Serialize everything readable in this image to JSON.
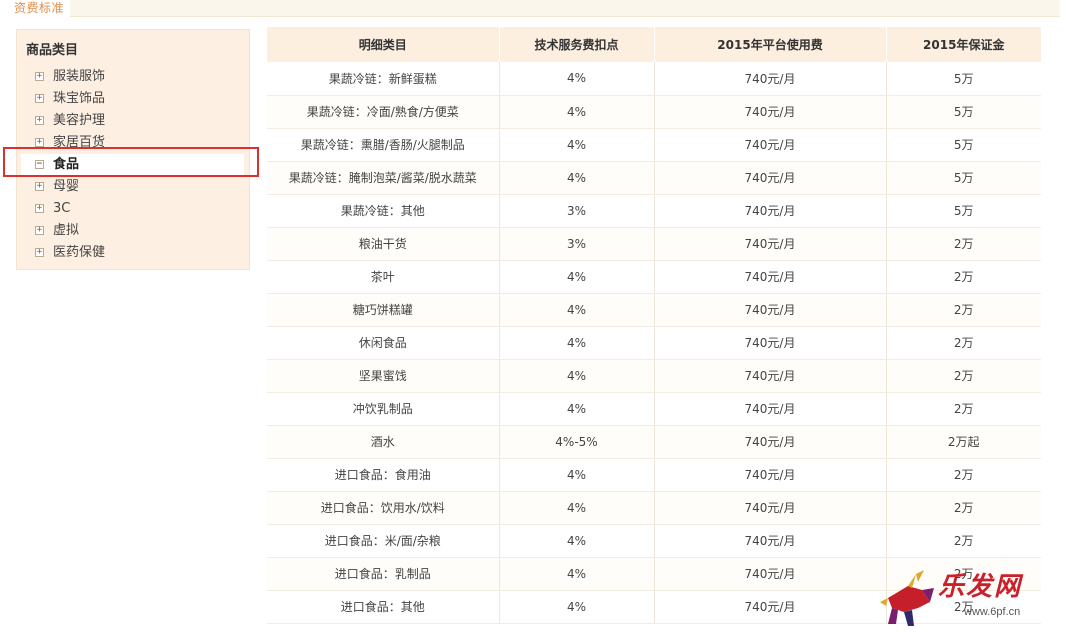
{
  "header": {
    "title": "资费标准"
  },
  "sidebar": {
    "title": "商品类目",
    "items": [
      {
        "label": "服装服饰",
        "toggle": "+"
      },
      {
        "label": "珠宝饰品",
        "toggle": "+"
      },
      {
        "label": "美容护理",
        "toggle": "+"
      },
      {
        "label": "家居百货",
        "toggle": "+"
      },
      {
        "label": "食品",
        "toggle": "−"
      },
      {
        "label": "母婴",
        "toggle": "+"
      },
      {
        "label": "3C",
        "toggle": "+"
      },
      {
        "label": "虚拟",
        "toggle": "+"
      },
      {
        "label": "医药保健",
        "toggle": "+"
      }
    ]
  },
  "table": {
    "headers": [
      "明细类目",
      "技术服务费扣点",
      "2015年平台使用费",
      "2015年保证金"
    ],
    "rows": [
      [
        "果蔬冷链：新鲜蛋糕",
        "4%",
        "740元/月",
        "5万"
      ],
      [
        "果蔬冷链：冷面/熟食/方便菜",
        "4%",
        "740元/月",
        "5万"
      ],
      [
        "果蔬冷链：熏腊/香肠/火腿制品",
        "4%",
        "740元/月",
        "5万"
      ],
      [
        "果蔬冷链：腌制泡菜/酱菜/脱水蔬菜",
        "4%",
        "740元/月",
        "5万"
      ],
      [
        "果蔬冷链：其他",
        "3%",
        "740元/月",
        "5万"
      ],
      [
        "粮油干货",
        "3%",
        "740元/月",
        "2万"
      ],
      [
        "茶叶",
        "4%",
        "740元/月",
        "2万"
      ],
      [
        "糖巧饼糕罐",
        "4%",
        "740元/月",
        "2万"
      ],
      [
        "休闲食品",
        "4%",
        "740元/月",
        "2万"
      ],
      [
        "坚果蜜饯",
        "4%",
        "740元/月",
        "2万"
      ],
      [
        "冲饮乳制品",
        "4%",
        "740元/月",
        "2万"
      ],
      [
        "酒水",
        "4%-5%",
        "740元/月",
        "2万起"
      ],
      [
        "进口食品：食用油",
        "4%",
        "740元/月",
        "2万"
      ],
      [
        "进口食品：饮用水/饮料",
        "4%",
        "740元/月",
        "2万"
      ],
      [
        "进口食品：米/面/杂粮",
        "4%",
        "740元/月",
        "2万"
      ],
      [
        "进口食品：乳制品",
        "4%",
        "740元/月",
        "2万"
      ],
      [
        "进口食品：其他",
        "4%",
        "740元/月",
        "2万"
      ]
    ]
  },
  "watermark": {
    "name": "乐发网",
    "url": "www.6pf.cn"
  }
}
